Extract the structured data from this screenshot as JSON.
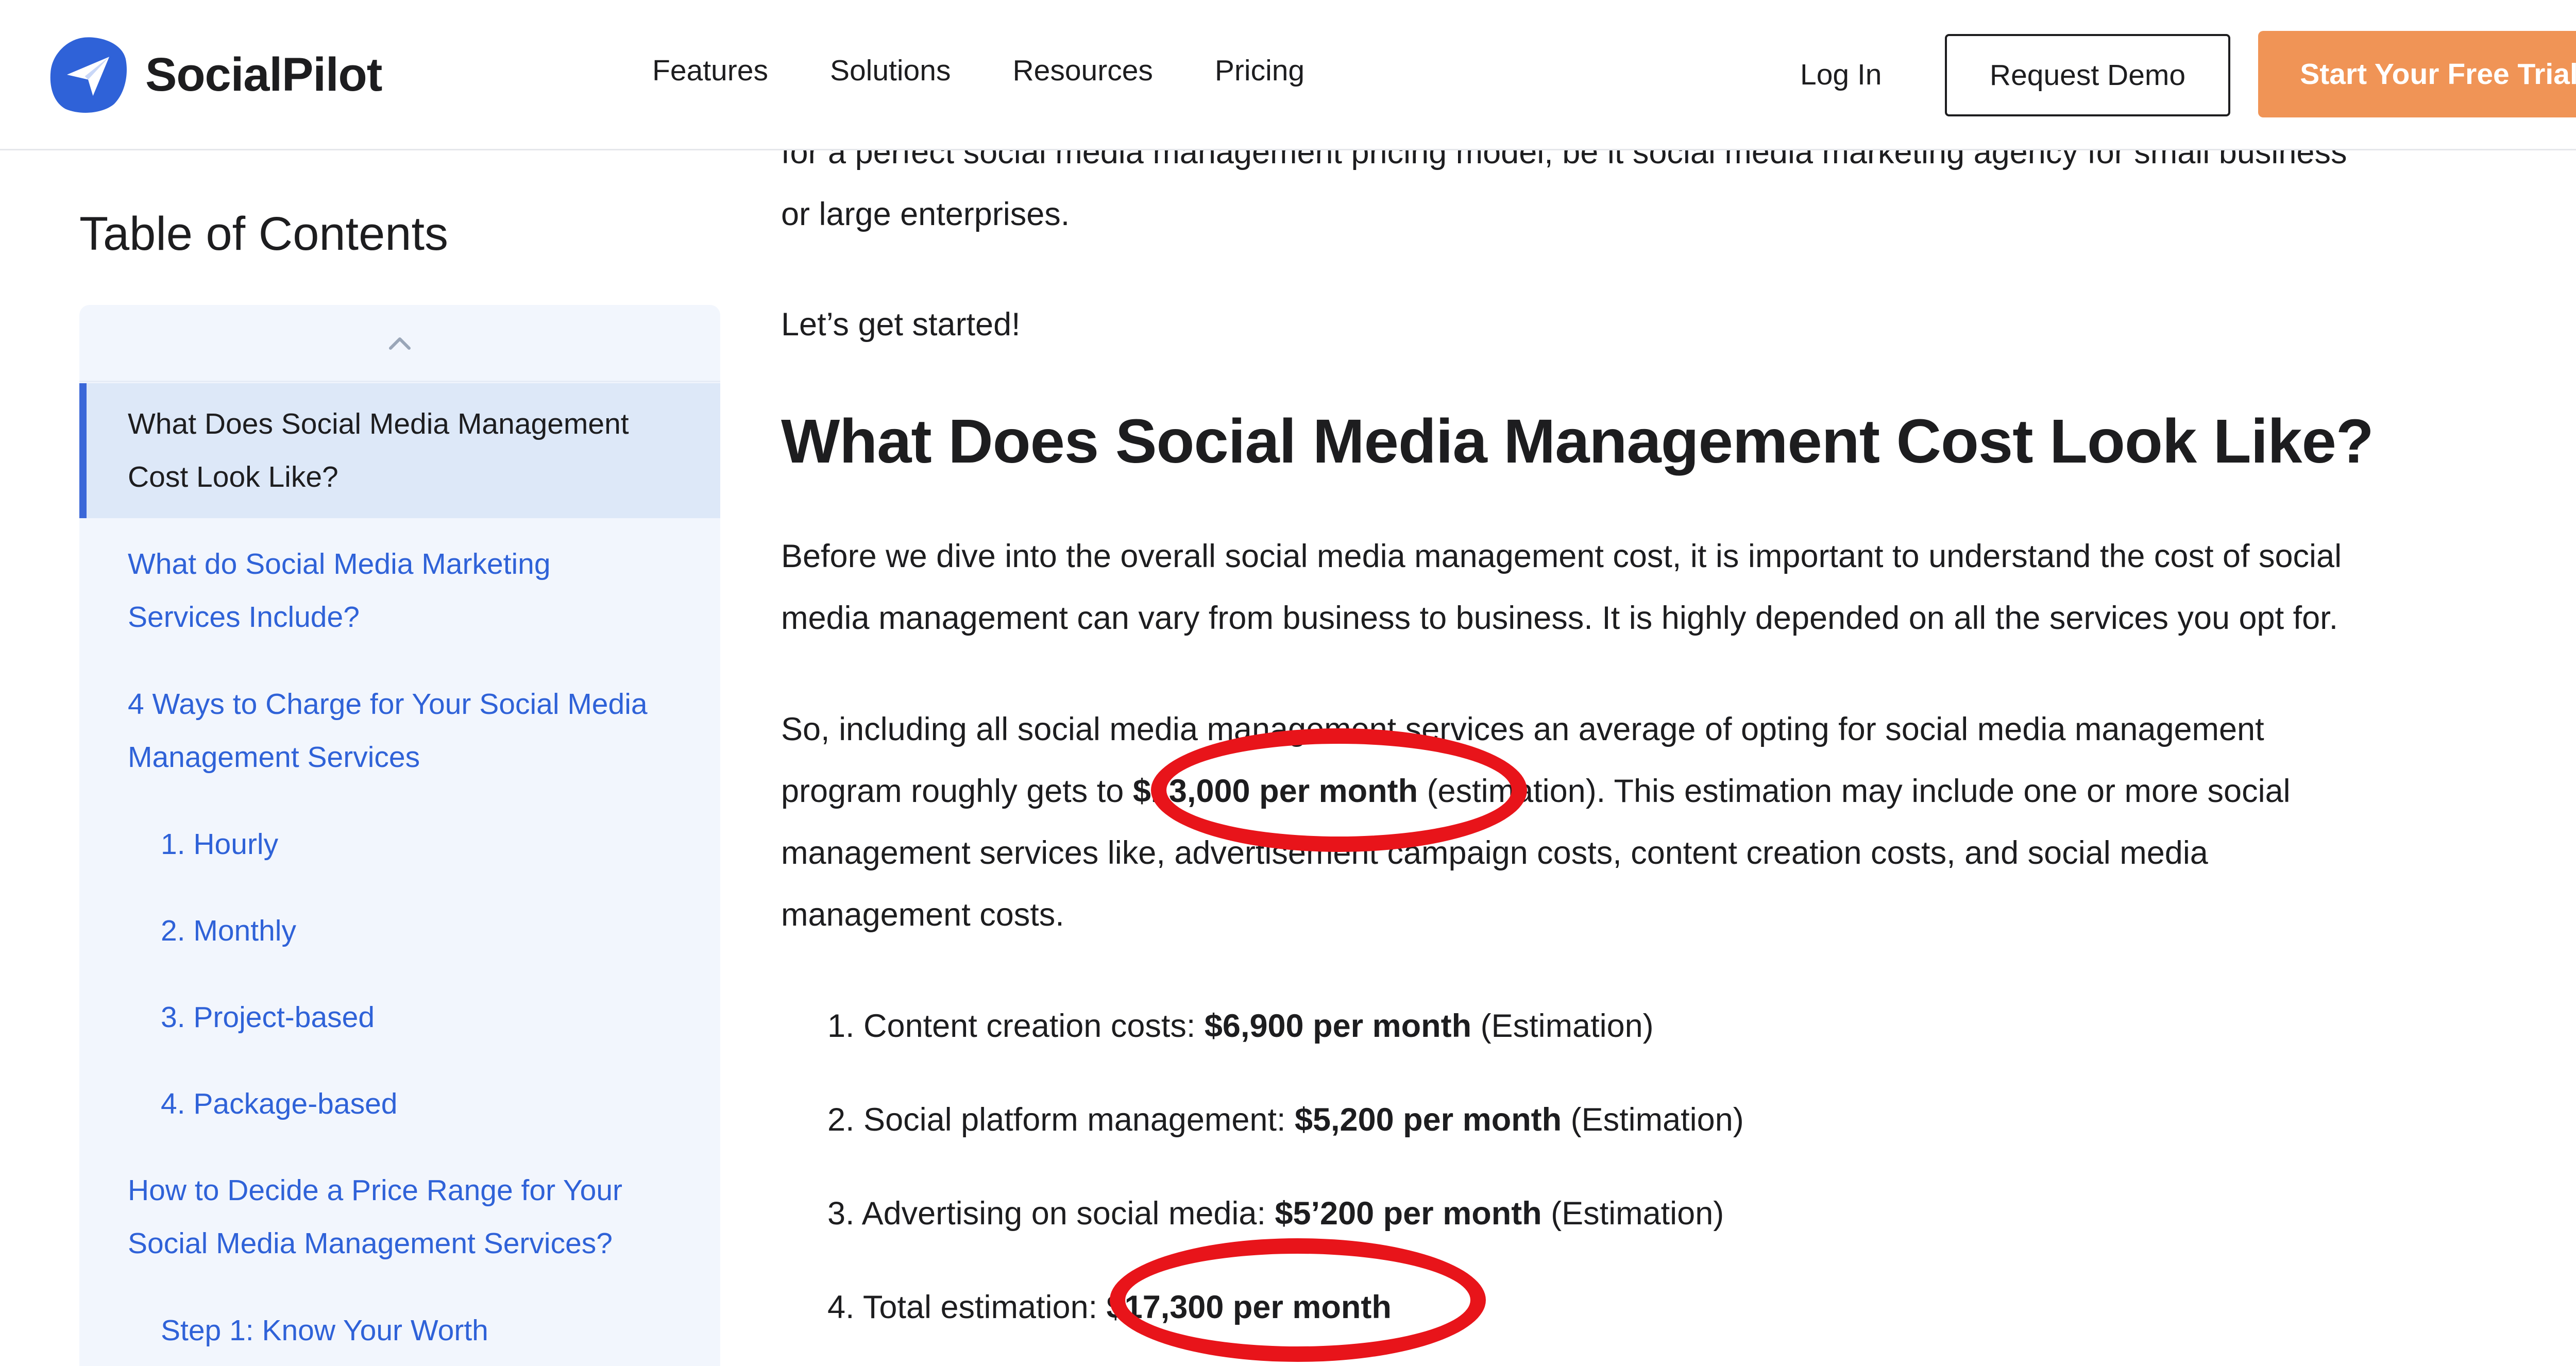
{
  "header": {
    "brand": "SocialPilot",
    "nav": [
      "Features",
      "Solutions",
      "Resources",
      "Pricing"
    ],
    "login": "Log In",
    "demo": "Request Demo",
    "trial": "Start Your Free Trial",
    "accent_color": "#f09456",
    "brand_color": "#2f62d8"
  },
  "toc": {
    "title": "Table of Contents",
    "items": [
      {
        "line1": "What Does Social Media Management",
        "line2": "Cost Look Like?"
      },
      {
        "line1": "What do Social Media Marketing",
        "line2": "Services Include?"
      },
      {
        "line1": "4 Ways to Charge for Your Social Media",
        "line2": "Management Services"
      },
      {
        "line1": "1. Hourly"
      },
      {
        "line1": "2. Monthly"
      },
      {
        "line1": "3. Project-based"
      },
      {
        "line1": "4. Package-based"
      },
      {
        "line1": "How to Decide a Price Range for Your",
        "line2": "Social Media Management Services?"
      },
      {
        "line1": "Step 1: Know Your Worth"
      }
    ]
  },
  "article": {
    "intro_line1": "for a perfect social media management pricing model, be it social media marketing agency for small business",
    "intro_line2": "or large enterprises.",
    "start": "Let’s get started!",
    "heading": "What Does Social Media Management Cost Look Like?",
    "p1_line1": "Before we dive into the overall social media management cost, it is important to understand the cost of social",
    "p1_line2": "media management can vary from business to business. It is highly depended on all the services you opt for.",
    "p2_line1": "So, including all social media management services an average of opting for social media management",
    "p2_line2_pre": "program roughly gets to ",
    "p2_line2_bold": "$13,000 per month",
    "p2_line2_post": " (estimation). This estimation may include one or more social",
    "p2_line3": "management services like, advertisement campaign costs, content creation costs, and social media",
    "p2_line4": "management costs.",
    "list": [
      {
        "label": "1. Content creation costs: ",
        "value": "$6,900 per month",
        "note": " (Estimation)"
      },
      {
        "label": "2. Social platform management: ",
        "value": "$5,200 per month",
        "note": " (Estimation)"
      },
      {
        "label": "3. Advertising on social media: ",
        "value": "$5’200 per month",
        "note": " (Estimation)"
      },
      {
        "label": "4. Total estimation: ",
        "value": "$17,300 per month",
        "note": ""
      }
    ]
  },
  "annotation_color": "#e8141a"
}
